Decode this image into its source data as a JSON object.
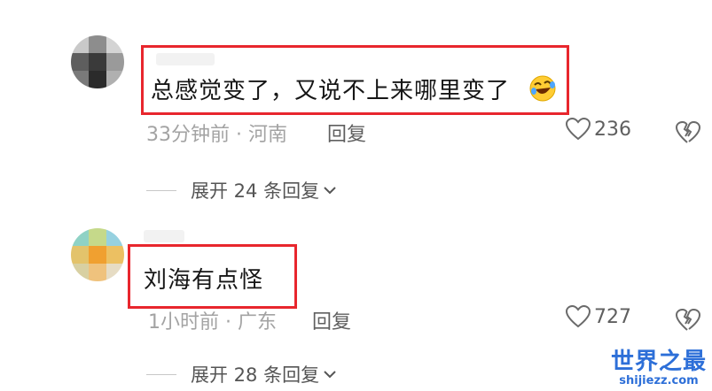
{
  "comments": [
    {
      "text": "总感觉变了，又说不上来哪里变了",
      "emoji": "rolling-on-floor-laughing-emoji",
      "time_location": "33分钟前 · 河南",
      "reply_label": "回复",
      "likes": "236",
      "expand_label": "展开 24 条回复"
    },
    {
      "text": "刘海有点怪",
      "time_location": "1小时前 · 广东",
      "reply_label": "回复",
      "likes": "727",
      "expand_label": "展开 28 条回复"
    }
  ],
  "watermark": {
    "title": "世界之最",
    "url": "shijiezz.com"
  },
  "colors": {
    "highlight_box": "#e8262d",
    "watermark": "#2d6fd8",
    "meta_text": "#a3a3a3"
  }
}
